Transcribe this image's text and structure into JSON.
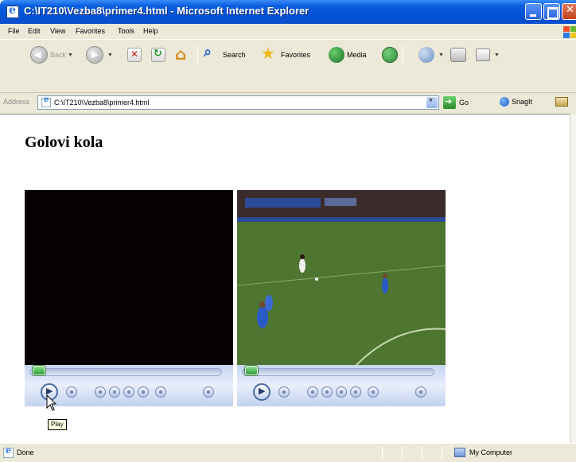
{
  "window": {
    "title": "C:\\IT210\\Vezba8\\primer4.html - Microsoft Internet Explorer"
  },
  "menu": {
    "items": [
      "File",
      "Edit",
      "View",
      "Favorites",
      "Tools",
      "Help"
    ]
  },
  "toolbar": {
    "back_label": "Back",
    "search_label": "Search",
    "favorites_label": "Favorites",
    "media_label": "Media"
  },
  "address": {
    "label": "Address",
    "value": "C:\\IT210\\Vezba8\\primer4.html",
    "go_label": "Go",
    "snagit_label": "SnagIt"
  },
  "page": {
    "heading": "Golovi kola"
  },
  "players": [
    {
      "state": "stopped",
      "video_frame": "black",
      "seek_position": 0.05
    },
    {
      "state": "playing",
      "video_frame": "football match",
      "seek_position": 0.05
    }
  ],
  "tooltip": {
    "text": "Play"
  },
  "status": {
    "text": "Done",
    "zone": "My Computer"
  },
  "colors": {
    "titlebar": "#0552d6",
    "video_black": "#050003",
    "pitch_green": "#4a6e2e"
  }
}
